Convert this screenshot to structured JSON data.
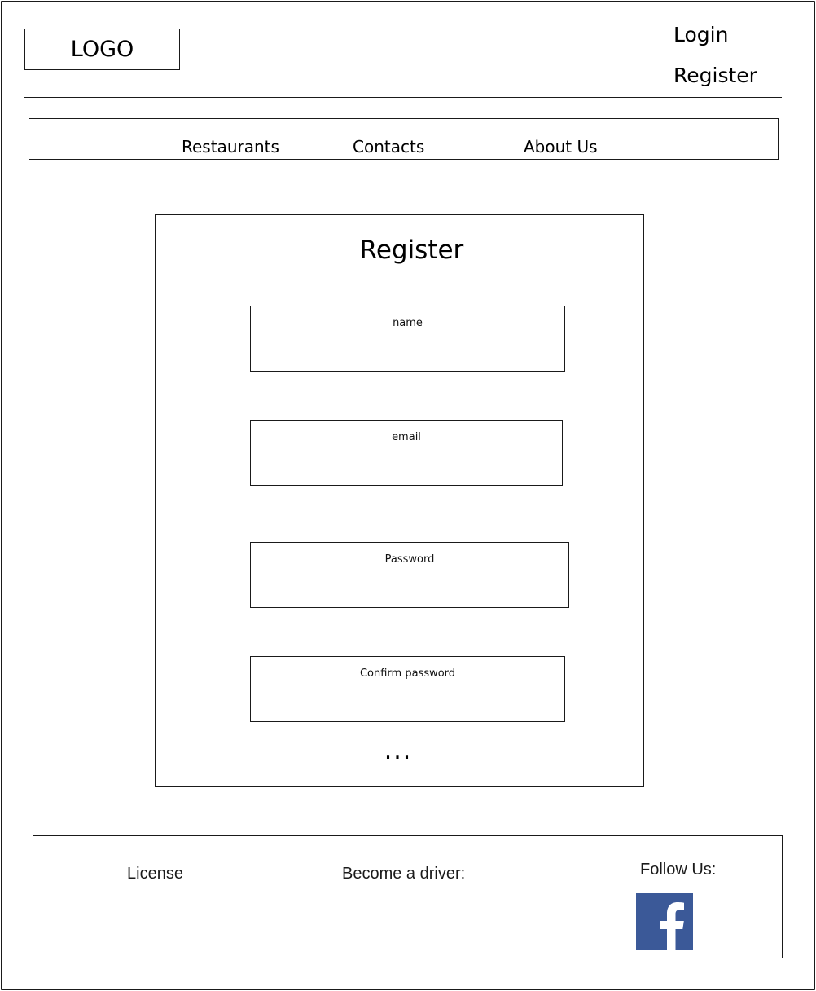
{
  "header": {
    "logo": "LOGO",
    "login": "Login",
    "register": "Register"
  },
  "nav": {
    "items": [
      {
        "label": "Restaurants"
      },
      {
        "label": "Contacts"
      },
      {
        "label": "About Us"
      }
    ]
  },
  "form": {
    "title": "Register",
    "fields": [
      {
        "label": "name"
      },
      {
        "label": "email"
      },
      {
        "label": "Password"
      },
      {
        "label": "Confirm password"
      }
    ],
    "more": "..."
  },
  "footer": {
    "license": "License",
    "driver": "Become a driver:",
    "follow": "Follow Us:",
    "social_icon": "facebook-icon",
    "social_color": "#3b5998"
  }
}
